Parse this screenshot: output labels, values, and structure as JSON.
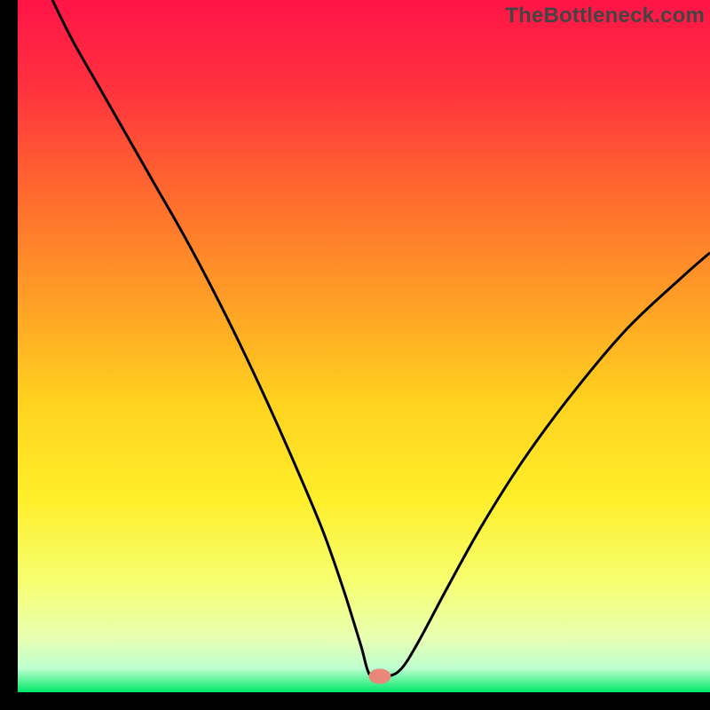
{
  "watermark": "TheBottleneck.com",
  "chart_data": {
    "type": "line",
    "title": "",
    "xlabel": "",
    "ylabel": "",
    "xlim": [
      0,
      100
    ],
    "ylim": [
      0,
      100
    ],
    "background_gradient": {
      "stops": [
        {
          "offset": 0.0,
          "color": "#ff1447"
        },
        {
          "offset": 0.12,
          "color": "#ff2f3f"
        },
        {
          "offset": 0.28,
          "color": "#ff6a2e"
        },
        {
          "offset": 0.42,
          "color": "#ff9a27"
        },
        {
          "offset": 0.58,
          "color": "#ffd21f"
        },
        {
          "offset": 0.72,
          "color": "#ffee2a"
        },
        {
          "offset": 0.84,
          "color": "#f6ff70"
        },
        {
          "offset": 0.92,
          "color": "#e9ffb0"
        },
        {
          "offset": 0.965,
          "color": "#bfffd0"
        },
        {
          "offset": 1.0,
          "color": "#00e86a"
        }
      ]
    },
    "series": [
      {
        "name": "curve",
        "color": "#000000",
        "x": [
          5,
          8,
          12,
          16,
          20,
          24,
          28,
          32,
          36,
          40,
          44,
          47,
          49.5,
          51,
          53.5,
          55.5,
          58,
          62,
          67,
          73,
          80,
          88,
          96,
          100
        ],
        "y": [
          100,
          94,
          87,
          80,
          73,
          66,
          58.5,
          50.5,
          42,
          33,
          23.5,
          15,
          7,
          2.3,
          2.3,
          3.5,
          7.5,
          15,
          24,
          33.5,
          43,
          52.5,
          60,
          63.5
        ]
      }
    ],
    "marker": {
      "x": 52.3,
      "y": 2.3,
      "rx": 1.6,
      "ry": 1.1,
      "color": "#e9877a"
    }
  }
}
